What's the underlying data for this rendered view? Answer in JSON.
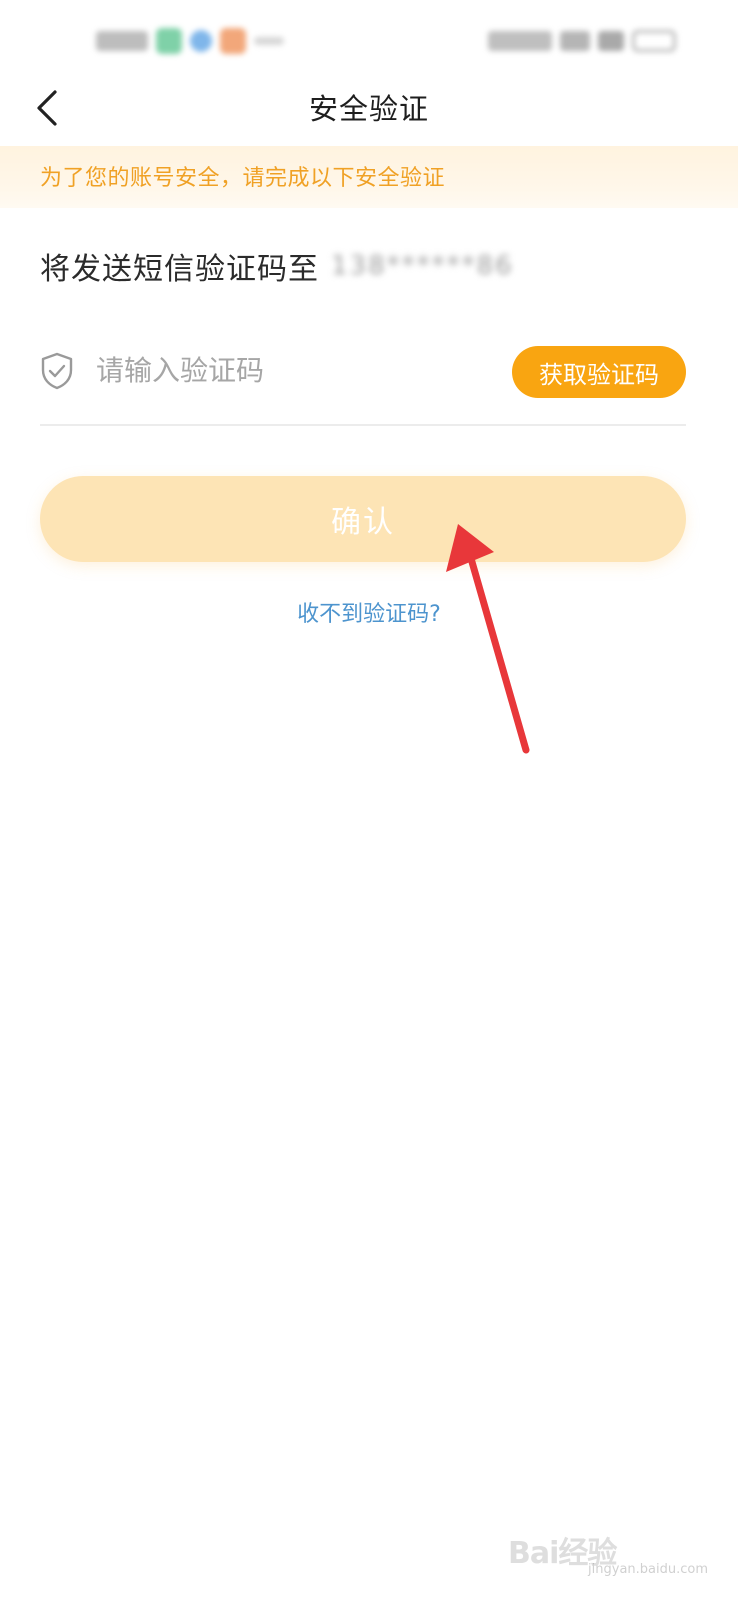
{
  "header": {
    "title": "安全验证"
  },
  "notice": {
    "text": "为了您的账号安全，请完成以下安全验证"
  },
  "sms": {
    "prefix": "将发送短信验证码至",
    "phone": "138******86"
  },
  "code_input": {
    "placeholder": "请输入验证码",
    "value": ""
  },
  "buttons": {
    "get_code_label": "获取验证码",
    "confirm_label": "确认"
  },
  "links": {
    "no_code": "收不到验证码?"
  },
  "watermark": {
    "logo_text": "Bai经验",
    "sub_text": "jingyan.baidu.com"
  },
  "colors": {
    "accent": "#f9a511",
    "confirm_disabled": "#fde4b5",
    "notice_text": "#f0a125",
    "link": "#4d94ce",
    "arrow": "#e8373a"
  },
  "icons": {
    "back": "chevron-left-icon",
    "shield": "shield-check-icon"
  }
}
